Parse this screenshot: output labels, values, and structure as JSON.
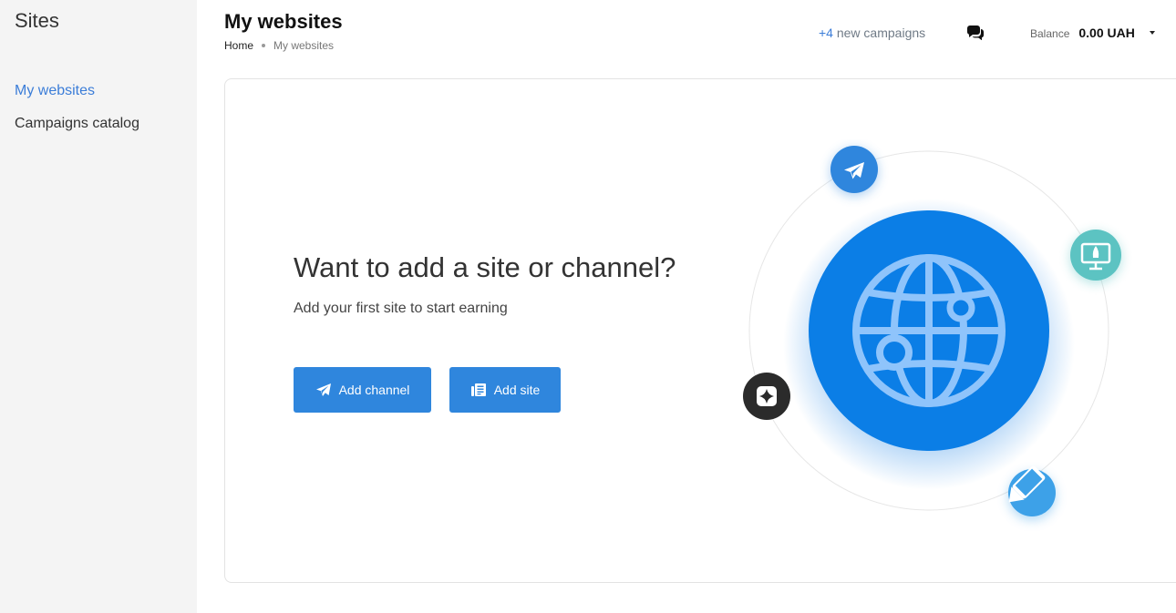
{
  "sidebar": {
    "title": "Sites",
    "items": [
      {
        "label": "My websites",
        "active": true
      },
      {
        "label": "Campaigns catalog",
        "active": false
      }
    ]
  },
  "header": {
    "title": "My websites",
    "breadcrumb": {
      "home": "Home",
      "current": "My websites"
    },
    "new_campaigns": {
      "count": "+4",
      "label": "new campaigns"
    },
    "balance": {
      "label": "Balance",
      "value": "0.00 UAH"
    }
  },
  "main": {
    "heading": "Want to add a site or channel?",
    "subheading": "Add your first site to start earning",
    "buttons": {
      "add_channel": "Add channel",
      "add_site": "Add site"
    }
  },
  "colors": {
    "accent": "#2f86dd",
    "link": "#3b7dd8",
    "globe": "#0a7de6",
    "teal": "#5cc3c2"
  },
  "icons": [
    "chat-icon",
    "telegram-icon",
    "document-icon",
    "globe-icon",
    "monitor-rocket-icon",
    "sparkle-icon",
    "pencil-icon",
    "caret-down-icon"
  ]
}
